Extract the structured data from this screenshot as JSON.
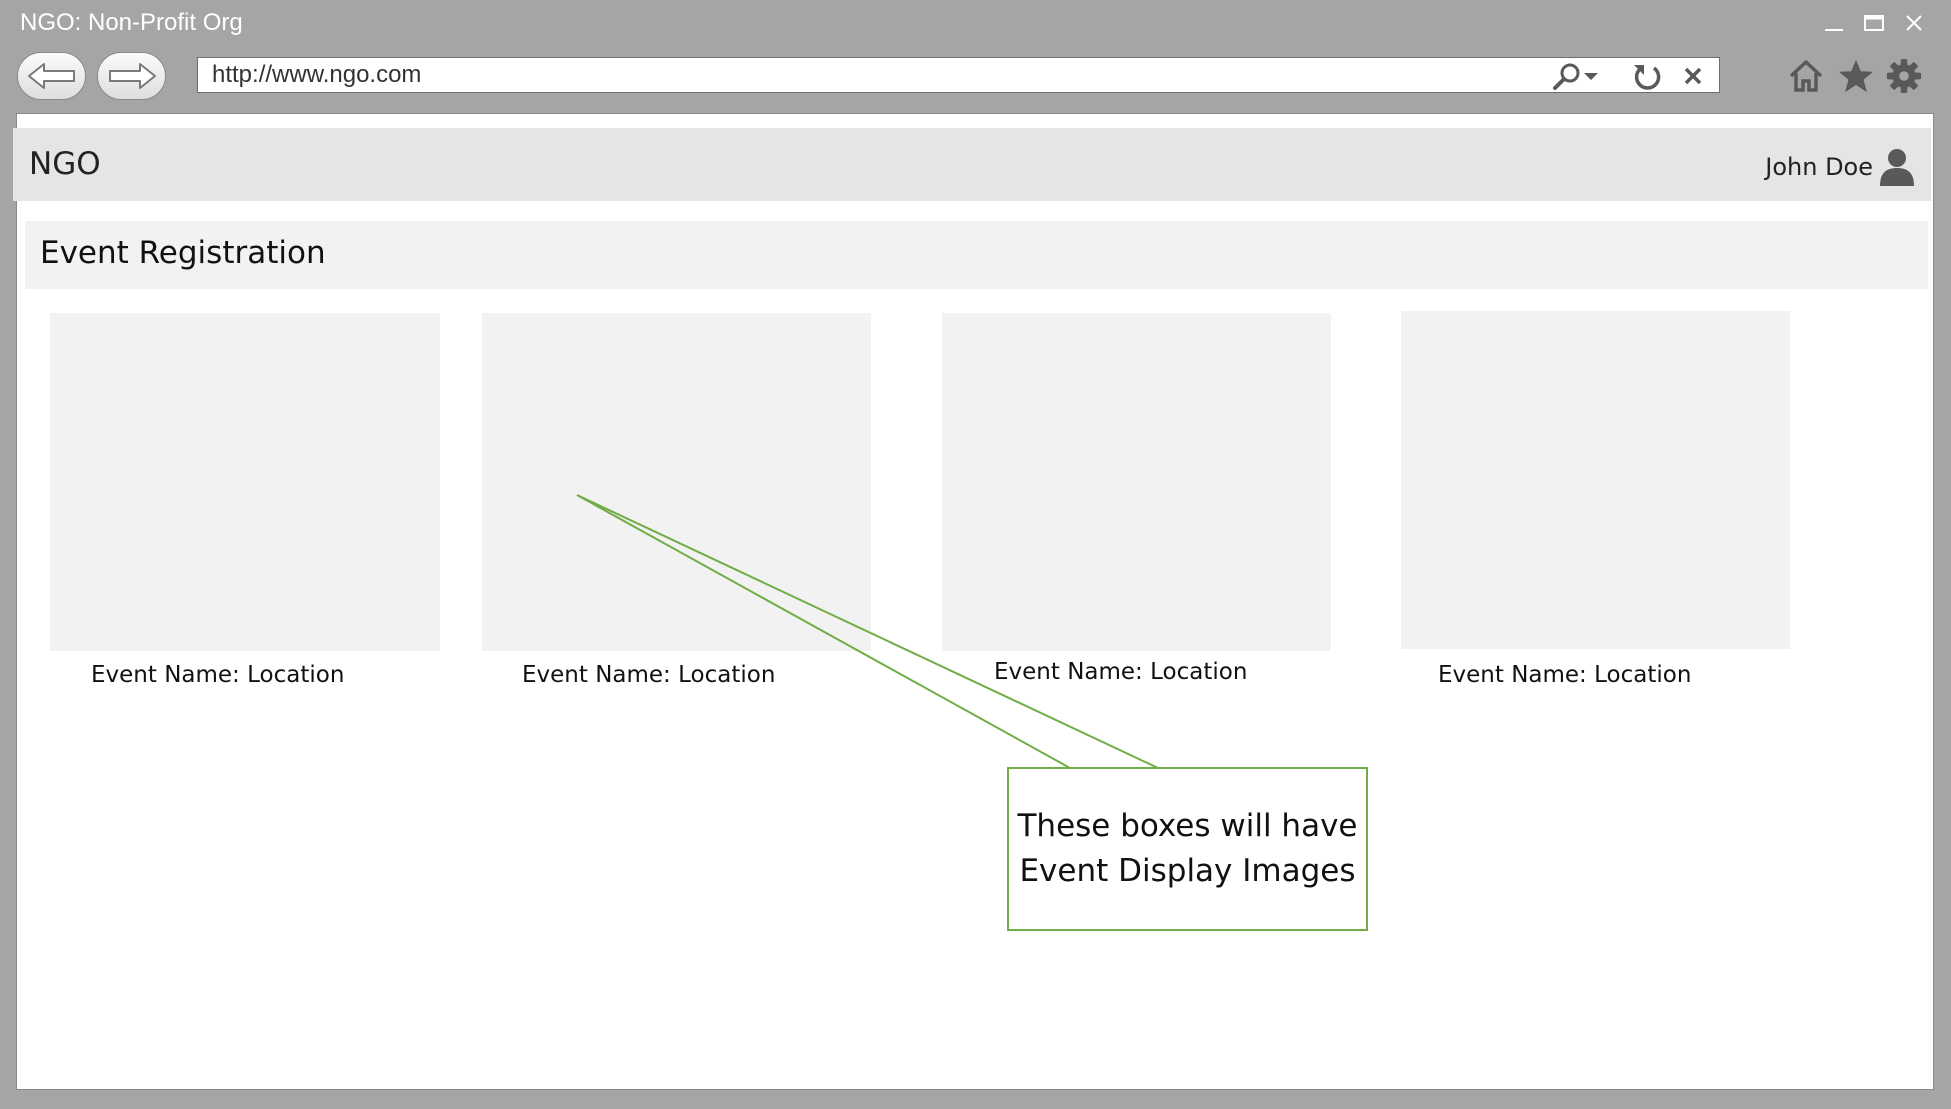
{
  "window": {
    "title": "NGO: Non-Profit Org"
  },
  "browser": {
    "url": "http://www.ngo.com",
    "icons": {
      "back": "back-arrow-icon",
      "forward": "forward-arrow-icon",
      "search": "search-icon",
      "refresh": "refresh-icon",
      "stop": "close-icon",
      "home": "home-icon",
      "favorites": "star-icon",
      "settings": "gear-icon"
    }
  },
  "header": {
    "brand": "NGO",
    "user_name": "John Doe"
  },
  "page": {
    "title": "Event Registration"
  },
  "events": [
    {
      "caption": "Event Name: Location"
    },
    {
      "caption": "Event Name: Location"
    },
    {
      "caption": "Event Name: Location"
    },
    {
      "caption": "Event Name: Location"
    }
  ],
  "annotation": {
    "text": "These boxes will have\nEvent Display Images"
  },
  "colors": {
    "chrome": "#a5a5a5",
    "header_bg": "#e5e5e5",
    "placeholder": "#f2f2f2",
    "annotation": "#70ad47",
    "icon": "#595959"
  }
}
